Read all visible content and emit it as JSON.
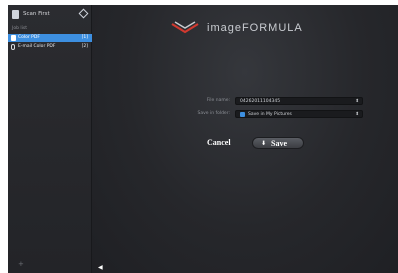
{
  "sidebar": {
    "scan_first": {
      "label": "Scan First",
      "icon": "scan-first-icon"
    },
    "top_right_icon": "diamond-icon",
    "job_list_title": "Job list",
    "jobs": [
      {
        "label": "Color PDF",
        "count": "[1]",
        "icon": "pdf-icon",
        "selected": true
      },
      {
        "label": "E-mail Color PDF",
        "count": "[2]",
        "icon": "paperclip-icon",
        "selected": false
      }
    ],
    "add_icon": "plus-icon"
  },
  "main": {
    "logo_text": "imageFORMULA",
    "form": {
      "file_name_label": "File name:",
      "file_name_value": "04262011104345",
      "save_in_folder_label": "Save in folder:",
      "save_in_folder_value": "Save in My Pictures"
    },
    "buttons": {
      "cancel_label": "Cancel",
      "save_label": "Save"
    },
    "back_icon": "back-arrow-icon"
  },
  "colors": {
    "sidebar_bg": "#2b2c30",
    "main_bg": "#26272b",
    "selected_item": "#3d8fe0",
    "text": "#d6d8dc"
  }
}
